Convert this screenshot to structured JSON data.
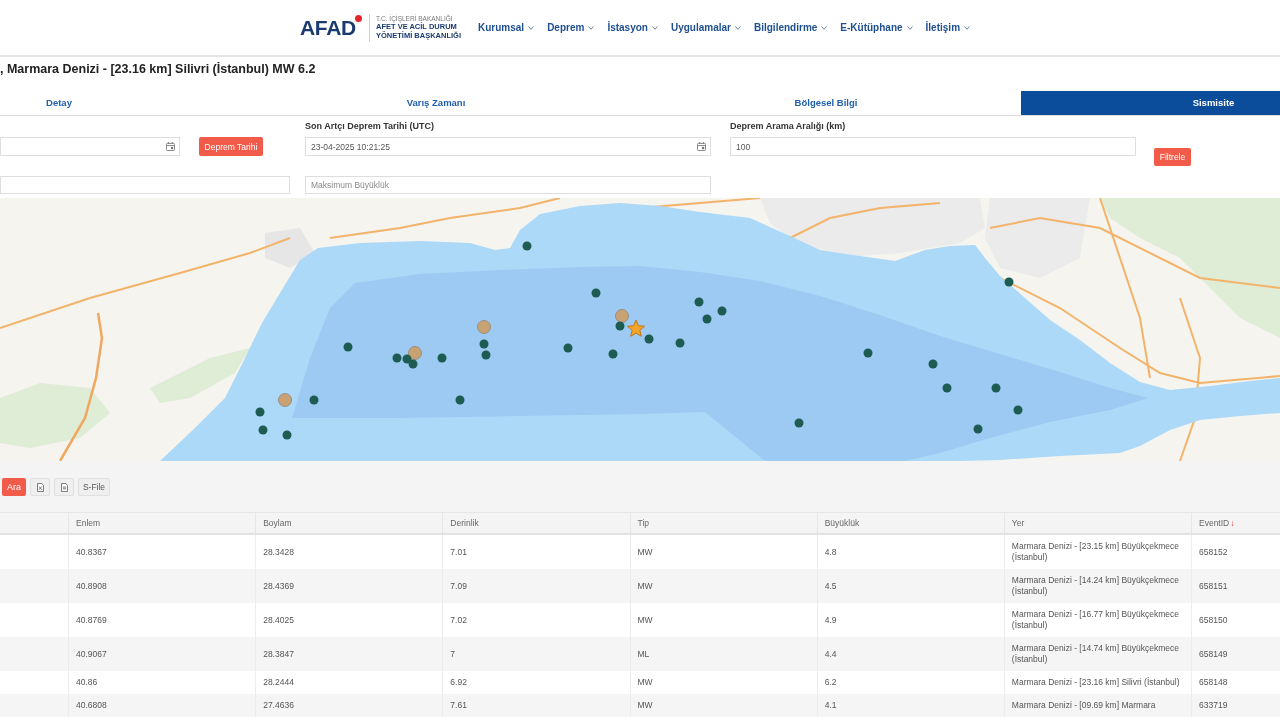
{
  "header": {
    "logo": {
      "text": "AFAD",
      "subtitle": [
        "T.C. İÇİŞLERİ BAKANLIĞI",
        "AFET VE ACİL DURUM",
        "YÖNETİMİ BAŞKANLIĞI"
      ]
    },
    "nav": [
      "Kurumsal",
      "Deprem",
      "İstasyon",
      "Uygulamalar",
      "Bilgilendirme",
      "E-Kütüphane",
      "İletişim"
    ]
  },
  "title": ", Marmara Denizi - [23.16 km] Silivri (İstanbul) MW 6.2",
  "tabs": [
    {
      "label": "Detay",
      "selected": false
    },
    {
      "label": "Varış Zamanı",
      "selected": false
    },
    {
      "label": "Bölgesel Bilgi",
      "selected": false
    },
    {
      "label": "Sismisite",
      "selected": true
    }
  ],
  "filters": [
    {
      "fields": [
        {
          "kind": "date"
        },
        {
          "kind": "text"
        }
      ],
      "button": "Deprem Tarihi"
    },
    {
      "label": "Son Artçı Deprem Tarihi (UTC)",
      "fields": [
        {
          "kind": "date",
          "value": "23-04-2025 10:21:25"
        },
        {
          "kind": "text",
          "placeholder": "Maksimum Büyüklük"
        }
      ]
    },
    {
      "label": "Deprem Arama Aralığı (km)",
      "fields": [
        {
          "kind": "text",
          "value": "100"
        }
      ],
      "button": "Filtrele"
    }
  ],
  "map": {
    "markers": [
      {
        "kind": "small",
        "color": "#1e5c53"
      },
      {
        "kind": "small",
        "color": "#1e5c53"
      },
      {
        "kind": "large",
        "color": "#c8a273"
      },
      {
        "kind": "small",
        "color": "#1e5c53"
      },
      {
        "kind": "large",
        "color": "#c8a273"
      },
      {
        "kind": "small",
        "color": "#1e5c53"
      },
      {
        "kind": "small",
        "color": "#1e5c53"
      },
      {
        "kind": "small",
        "color": "#1e5c53"
      },
      {
        "kind": "large",
        "color": "#c8a273"
      },
      {
        "kind": "small",
        "color": "#1e5c53"
      },
      {
        "kind": "small",
        "color": "#1e5c53"
      },
      {
        "kind": "small",
        "color": "#1e5c53"
      },
      {
        "kind": "small",
        "color": "#1e5c53"
      },
      {
        "kind": "small",
        "color": "#1e5c53"
      },
      {
        "kind": "small",
        "color": "#1e5c53"
      },
      {
        "kind": "large",
        "color": "#c8a273"
      },
      {
        "kind": "small",
        "color": "#1e5c53"
      },
      {
        "kind": "small",
        "color": "#1e5c53"
      },
      {
        "kind": "small",
        "color": "#1e5c53"
      },
      {
        "kind": "small",
        "color": "#1e5c53"
      },
      {
        "kind": "small",
        "color": "#1e5c53"
      },
      {
        "kind": "small",
        "color": "#1e5c53"
      },
      {
        "kind": "small",
        "color": "#1e5c53"
      },
      {
        "kind": "small",
        "color": "#1e5c53"
      },
      {
        "kind": "small",
        "color": "#1e5c53"
      },
      {
        "kind": "small",
        "color": "#1e5c53"
      },
      {
        "kind": "small",
        "color": "#1e5c53"
      },
      {
        "kind": "small",
        "color": "#1e5c53"
      },
      {
        "kind": "small",
        "color": "#1e5c53"
      },
      {
        "kind": "small",
        "color": "#1e5c53"
      },
      {
        "kind": "small",
        "color": "#1e5c53"
      },
      {
        "kind": "small",
        "color": "#1e5c53"
      },
      {
        "kind": "small",
        "color": "#1e5c53"
      },
      {
        "kind": "small",
        "color": "#1e5c53"
      },
      {
        "kind": "star",
        "color": "#f4a62a"
      }
    ]
  },
  "toolbar": {
    "buttons": [
      {
        "kind": "primary",
        "label": "Ara"
      },
      {
        "kind": "icon"
      },
      {
        "kind": "icon"
      },
      {
        "kind": "plain",
        "label": "S-File"
      }
    ]
  },
  "table": {
    "columns": [
      {
        "label": "Enlem"
      },
      {
        "label": "Boylam"
      },
      {
        "label": "Derinlik"
      },
      {
        "label": "Tip"
      },
      {
        "label": "Büyüklük"
      },
      {
        "label": "Yer"
      },
      {
        "label": "EventID",
        "sort_arrow": "↓"
      }
    ],
    "rows": [
      [
        "40.8367",
        "28.3428",
        "7.01",
        "MW",
        "4.8",
        "Marmara Denizi - [23.15 km] Büyükçekmece (İstanbul)",
        "658152"
      ],
      [
        "40.8908",
        "28.4369",
        "7.09",
        "MW",
        "4.5",
        "Marmara Denizi - [14.24 km] Büyükçekmece (İstanbul)",
        "658151"
      ],
      [
        "40.8769",
        "28.4025",
        "7.02",
        "MW",
        "4.9",
        "Marmara Denizi - [16.77 km] Büyükçekmece (İstanbul)",
        "658150"
      ],
      [
        "40.9067",
        "28.3847",
        "7",
        "ML",
        "4.4",
        "Marmara Denizi - [14.74 km] Büyükçekmece (İstanbul)",
        "658149"
      ],
      [
        "40.86",
        "28.2444",
        "6.92",
        "MW",
        "6.2",
        "Marmara Denizi - [23.16 km] Silivri (İstanbul)",
        "658148"
      ],
      [
        "40.6808",
        "27.4636",
        "7.61",
        "MW",
        "4.1",
        "Marmara Denizi - [09.69 km] Marmara",
        "633719"
      ]
    ]
  }
}
